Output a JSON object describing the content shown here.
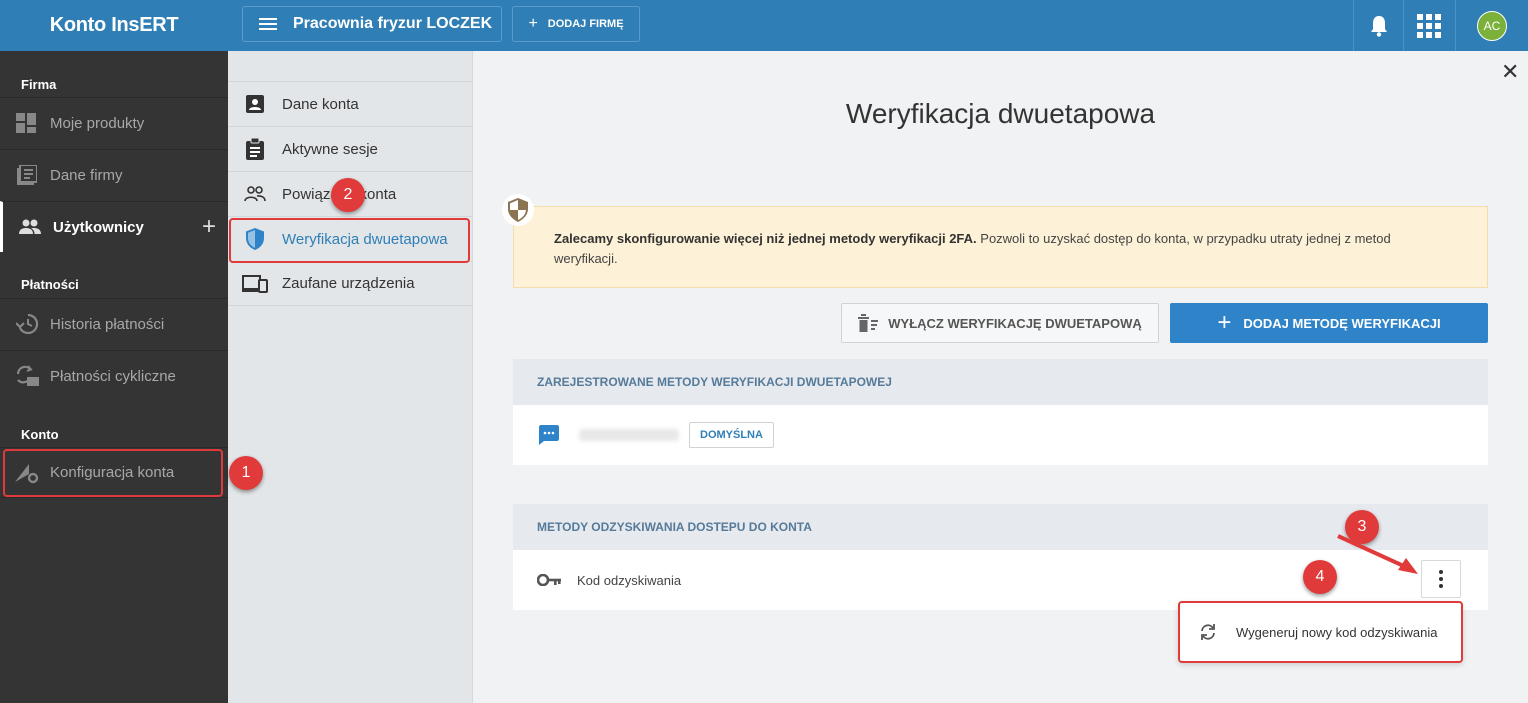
{
  "topbar": {
    "brand": "Konto InsERT",
    "company": "Pracownia fryzur LOCZEK",
    "add_company": "DODAJ FIRMĘ",
    "avatar_initials": "AC"
  },
  "sidebar": {
    "sections": [
      {
        "label": "Firma"
      },
      {
        "label": "Płatności"
      },
      {
        "label": "Konto"
      }
    ],
    "items": [
      {
        "label": "Moje produkty",
        "icon": "dashboard-icon"
      },
      {
        "label": "Dane firmy",
        "icon": "document-list-icon"
      },
      {
        "label": "Użytkownicy",
        "icon": "users-icon"
      },
      {
        "label": "Historia płatności",
        "icon": "history-icon"
      },
      {
        "label": "Płatności cykliczne",
        "icon": "recurring-payment-icon"
      },
      {
        "label": "Konfiguracja konta",
        "icon": "account-settings-icon"
      }
    ]
  },
  "subnav": {
    "items": [
      {
        "label": "Dane konta"
      },
      {
        "label": "Aktywne sesje"
      },
      {
        "label": "Powiązane konta"
      },
      {
        "label": "Weryfikacja dwuetapowa"
      },
      {
        "label": "Zaufane urządzenia"
      }
    ]
  },
  "main": {
    "title": "Weryfikacja dwuetapowa",
    "warning_bold": "Zalecamy skonfigurowanie więcej niż jednej metody weryfikacji 2FA.",
    "warning_text": " Pozwoli to uzyskać dostęp do konta, w przypadku utraty jednej z metod weryfikacji.",
    "btn_disable": "WYŁĄCZ WERYFIKACJĘ DWUETAPOWĄ",
    "btn_add": "DODAJ METODĘ WERYFIKACJI",
    "registered_header": "ZAREJESTROWANE METODY WERYFIKACJI DWUETAPOWEJ",
    "default_badge": "DOMYŚLNA",
    "recovery_header": "METODY ODZYSKIWANIA DOSTEPU DO KONTA",
    "recovery_code": "Kod odzyskiwania",
    "menu_regenerate": "Wygeneruj nowy kod odzyskiwania"
  },
  "annotations": [
    "1",
    "2",
    "3",
    "4"
  ],
  "colors": {
    "accent": "#2f7fb6",
    "highlight": "#e03a3a",
    "sidebar": "#343434"
  }
}
